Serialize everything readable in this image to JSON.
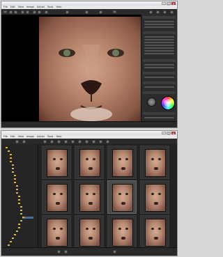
{
  "window1": {
    "menu": [
      "File",
      "Edit",
      "View",
      "Image",
      "Adjust",
      "Tools",
      "Help"
    ]
  },
  "window2": {
    "menu": [
      "File",
      "Edit",
      "View",
      "Image",
      "Adjust",
      "Tools",
      "Help"
    ]
  },
  "win_controls": {
    "minimize": "–",
    "maximize": "□",
    "close": "×"
  },
  "colors": {
    "toolbar": "#2a2a2a",
    "panel": "#2c2c2c",
    "folder": "#d8b44a",
    "selection": "#4a6a9a"
  },
  "icons": [
    "open-folder-icon",
    "back-icon",
    "forward-icon",
    "rotate-icon",
    "zoom-icon",
    "settings-icon",
    "color-wheel-icon",
    "knob-icon"
  ]
}
